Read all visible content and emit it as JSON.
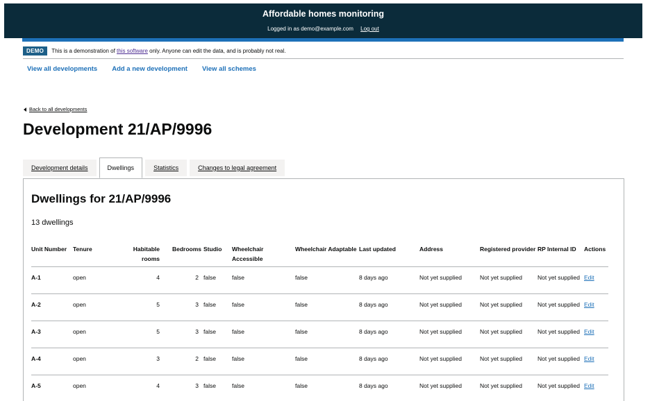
{
  "header": {
    "title": "Affordable homes monitoring",
    "logged_in_text": "Logged in as demo@example.com",
    "logout_label": "Log out"
  },
  "demo_banner": {
    "tag": "DEMO",
    "text_before": "This is a demonstration of ",
    "link_text": "this software",
    "text_after": " only. Anyone can edit the data, and is probably not real."
  },
  "nav": {
    "items": [
      "View all developments",
      "Add a new development",
      "View all schemes"
    ]
  },
  "back_link": "Back to all developments",
  "page_title": "Development 21/AP/9996",
  "tabs": [
    {
      "label": "Development details",
      "active": false
    },
    {
      "label": "Dwellings",
      "active": true
    },
    {
      "label": "Statistics",
      "active": false
    },
    {
      "label": "Changes to legal agreement",
      "active": false
    }
  ],
  "panel": {
    "title": "Dwellings for 21/AP/9996",
    "count_text": "13 dwellings"
  },
  "table": {
    "columns": [
      "Unit Number",
      "Tenure",
      "Habitable rooms",
      "Bedrooms",
      "Studio",
      "Wheelchair Accessible",
      "Wheelchair Adaptable",
      "Last updated",
      "Address",
      "Registered provider",
      "RP Internal ID",
      "Actions"
    ],
    "rows": [
      {
        "unit": "A-1",
        "tenure": "open",
        "rooms": "4",
        "bedrooms": "2",
        "studio": "false",
        "accessible": "false",
        "adaptable": "false",
        "updated": "8 days ago",
        "address": "Not yet supplied",
        "provider": "Not yet supplied",
        "rp_id": "Not yet supplied",
        "action": "Edit"
      },
      {
        "unit": "A-2",
        "tenure": "open",
        "rooms": "5",
        "bedrooms": "3",
        "studio": "false",
        "accessible": "false",
        "adaptable": "false",
        "updated": "8 days ago",
        "address": "Not yet supplied",
        "provider": "Not yet supplied",
        "rp_id": "Not yet supplied",
        "action": "Edit"
      },
      {
        "unit": "A-3",
        "tenure": "open",
        "rooms": "5",
        "bedrooms": "3",
        "studio": "false",
        "accessible": "false",
        "adaptable": "false",
        "updated": "8 days ago",
        "address": "Not yet supplied",
        "provider": "Not yet supplied",
        "rp_id": "Not yet supplied",
        "action": "Edit"
      },
      {
        "unit": "A-4",
        "tenure": "open",
        "rooms": "3",
        "bedrooms": "2",
        "studio": "false",
        "accessible": "false",
        "adaptable": "false",
        "updated": "8 days ago",
        "address": "Not yet supplied",
        "provider": "Not yet supplied",
        "rp_id": "Not yet supplied",
        "action": "Edit"
      },
      {
        "unit": "A-5",
        "tenure": "open",
        "rooms": "4",
        "bedrooms": "3",
        "studio": "false",
        "accessible": "false",
        "adaptable": "false",
        "updated": "8 days ago",
        "address": "Not yet supplied",
        "provider": "Not yet supplied",
        "rp_id": "Not yet supplied",
        "action": "Edit"
      }
    ]
  },
  "colors": {
    "header_bg": "#0b2b3a",
    "accent_bar": "#1d70b8",
    "demo_tag": "#1d5f88",
    "link": "#1d70b8"
  }
}
